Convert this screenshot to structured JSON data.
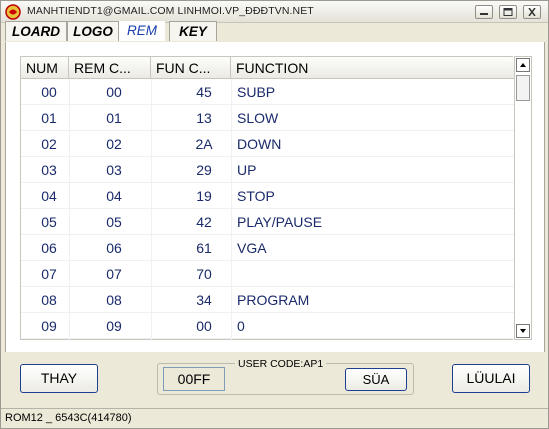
{
  "window": {
    "title": "MANHTIENDT1@GMAIL.COM  LINHMOI.VP_ĐĐĐTVN.NET"
  },
  "tabs": [
    {
      "label": "LOARD"
    },
    {
      "label": "LOGO"
    },
    {
      "label": "REM",
      "active": true
    },
    {
      "label": "KEY"
    }
  ],
  "table": {
    "columns": [
      "NUM",
      "REM C...",
      "FUN C...",
      "FUNCTION"
    ],
    "rows": [
      {
        "num": "00",
        "rem": "00",
        "fun": "45",
        "function": "SUBP"
      },
      {
        "num": "01",
        "rem": "01",
        "fun": "13",
        "function": "SLOW"
      },
      {
        "num": "02",
        "rem": "02",
        "fun": "2A",
        "function": "DOWN"
      },
      {
        "num": "03",
        "rem": "03",
        "fun": "29",
        "function": "UP"
      },
      {
        "num": "04",
        "rem": "04",
        "fun": "19",
        "function": "STOP"
      },
      {
        "num": "05",
        "rem": "05",
        "fun": "42",
        "function": "PLAY/PAUSE"
      },
      {
        "num": "06",
        "rem": "06",
        "fun": "61",
        "function": "VGA"
      },
      {
        "num": "07",
        "rem": "07",
        "fun": "70",
        "function": ""
      },
      {
        "num": "08",
        "rem": "08",
        "fun": "34",
        "function": "PROGRAM"
      },
      {
        "num": "09",
        "rem": "09",
        "fun": "00",
        "function": "0"
      }
    ]
  },
  "buttons": {
    "thay": "THAY",
    "sua": "SÜA",
    "luulai": "LÜULAI"
  },
  "user_code": {
    "label": "USER CODE:AP1",
    "value": "00FF"
  },
  "status": {
    "text": "ROM12 _ 6543C(414780)"
  },
  "icons": {
    "app": "app-logo-icon",
    "minimize": "minimize-icon",
    "maximize": "maximize-icon",
    "close": "close-icon",
    "scroll_up": "arrow-up-icon",
    "scroll_down": "arrow-down-icon"
  },
  "colors": {
    "active_tab": "#1a3fb0",
    "cell_text": "#1a2a6a",
    "button_border": "#1c3f94"
  }
}
